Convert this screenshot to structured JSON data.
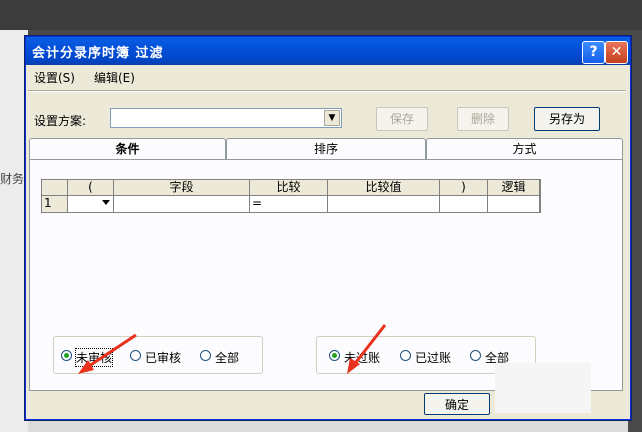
{
  "background": {
    "left_text": "财务"
  },
  "window": {
    "title": "会计分录序时簿 过滤",
    "help_label": "?",
    "close_label": "✕"
  },
  "menu": [
    {
      "label": "设置(S)"
    },
    {
      "label": "编辑(E)"
    }
  ],
  "scheme": {
    "label": "设置方案:",
    "value": "",
    "save_label": "保存",
    "delete_label": "删除",
    "save_as_label": "另存为"
  },
  "tabs": [
    {
      "label": "条件",
      "active": true
    },
    {
      "label": "排序",
      "active": false
    },
    {
      "label": "方式",
      "active": false
    }
  ],
  "grid": {
    "columns": [
      "",
      "(",
      "字段",
      "比较",
      "比较值",
      ")",
      "逻辑"
    ],
    "rows": [
      {
        "num": "1",
        "open_paren": "",
        "field": "",
        "compare": "=",
        "value": "",
        "close_paren": "",
        "logic": ""
      }
    ]
  },
  "audit_group": {
    "options": [
      {
        "label": "未审核",
        "checked": true
      },
      {
        "label": "已审核",
        "checked": false
      },
      {
        "label": "全部",
        "checked": false
      }
    ]
  },
  "posting_group": {
    "options": [
      {
        "label": "未过账",
        "checked": true
      },
      {
        "label": "已过账",
        "checked": false
      },
      {
        "label": "全部",
        "checked": false
      }
    ]
  },
  "footer": {
    "ok_label": "确定"
  },
  "colors": {
    "title_bar": "#0350d8",
    "annotation_arrow": "#e8321e",
    "radio_checked": "#21a121"
  }
}
